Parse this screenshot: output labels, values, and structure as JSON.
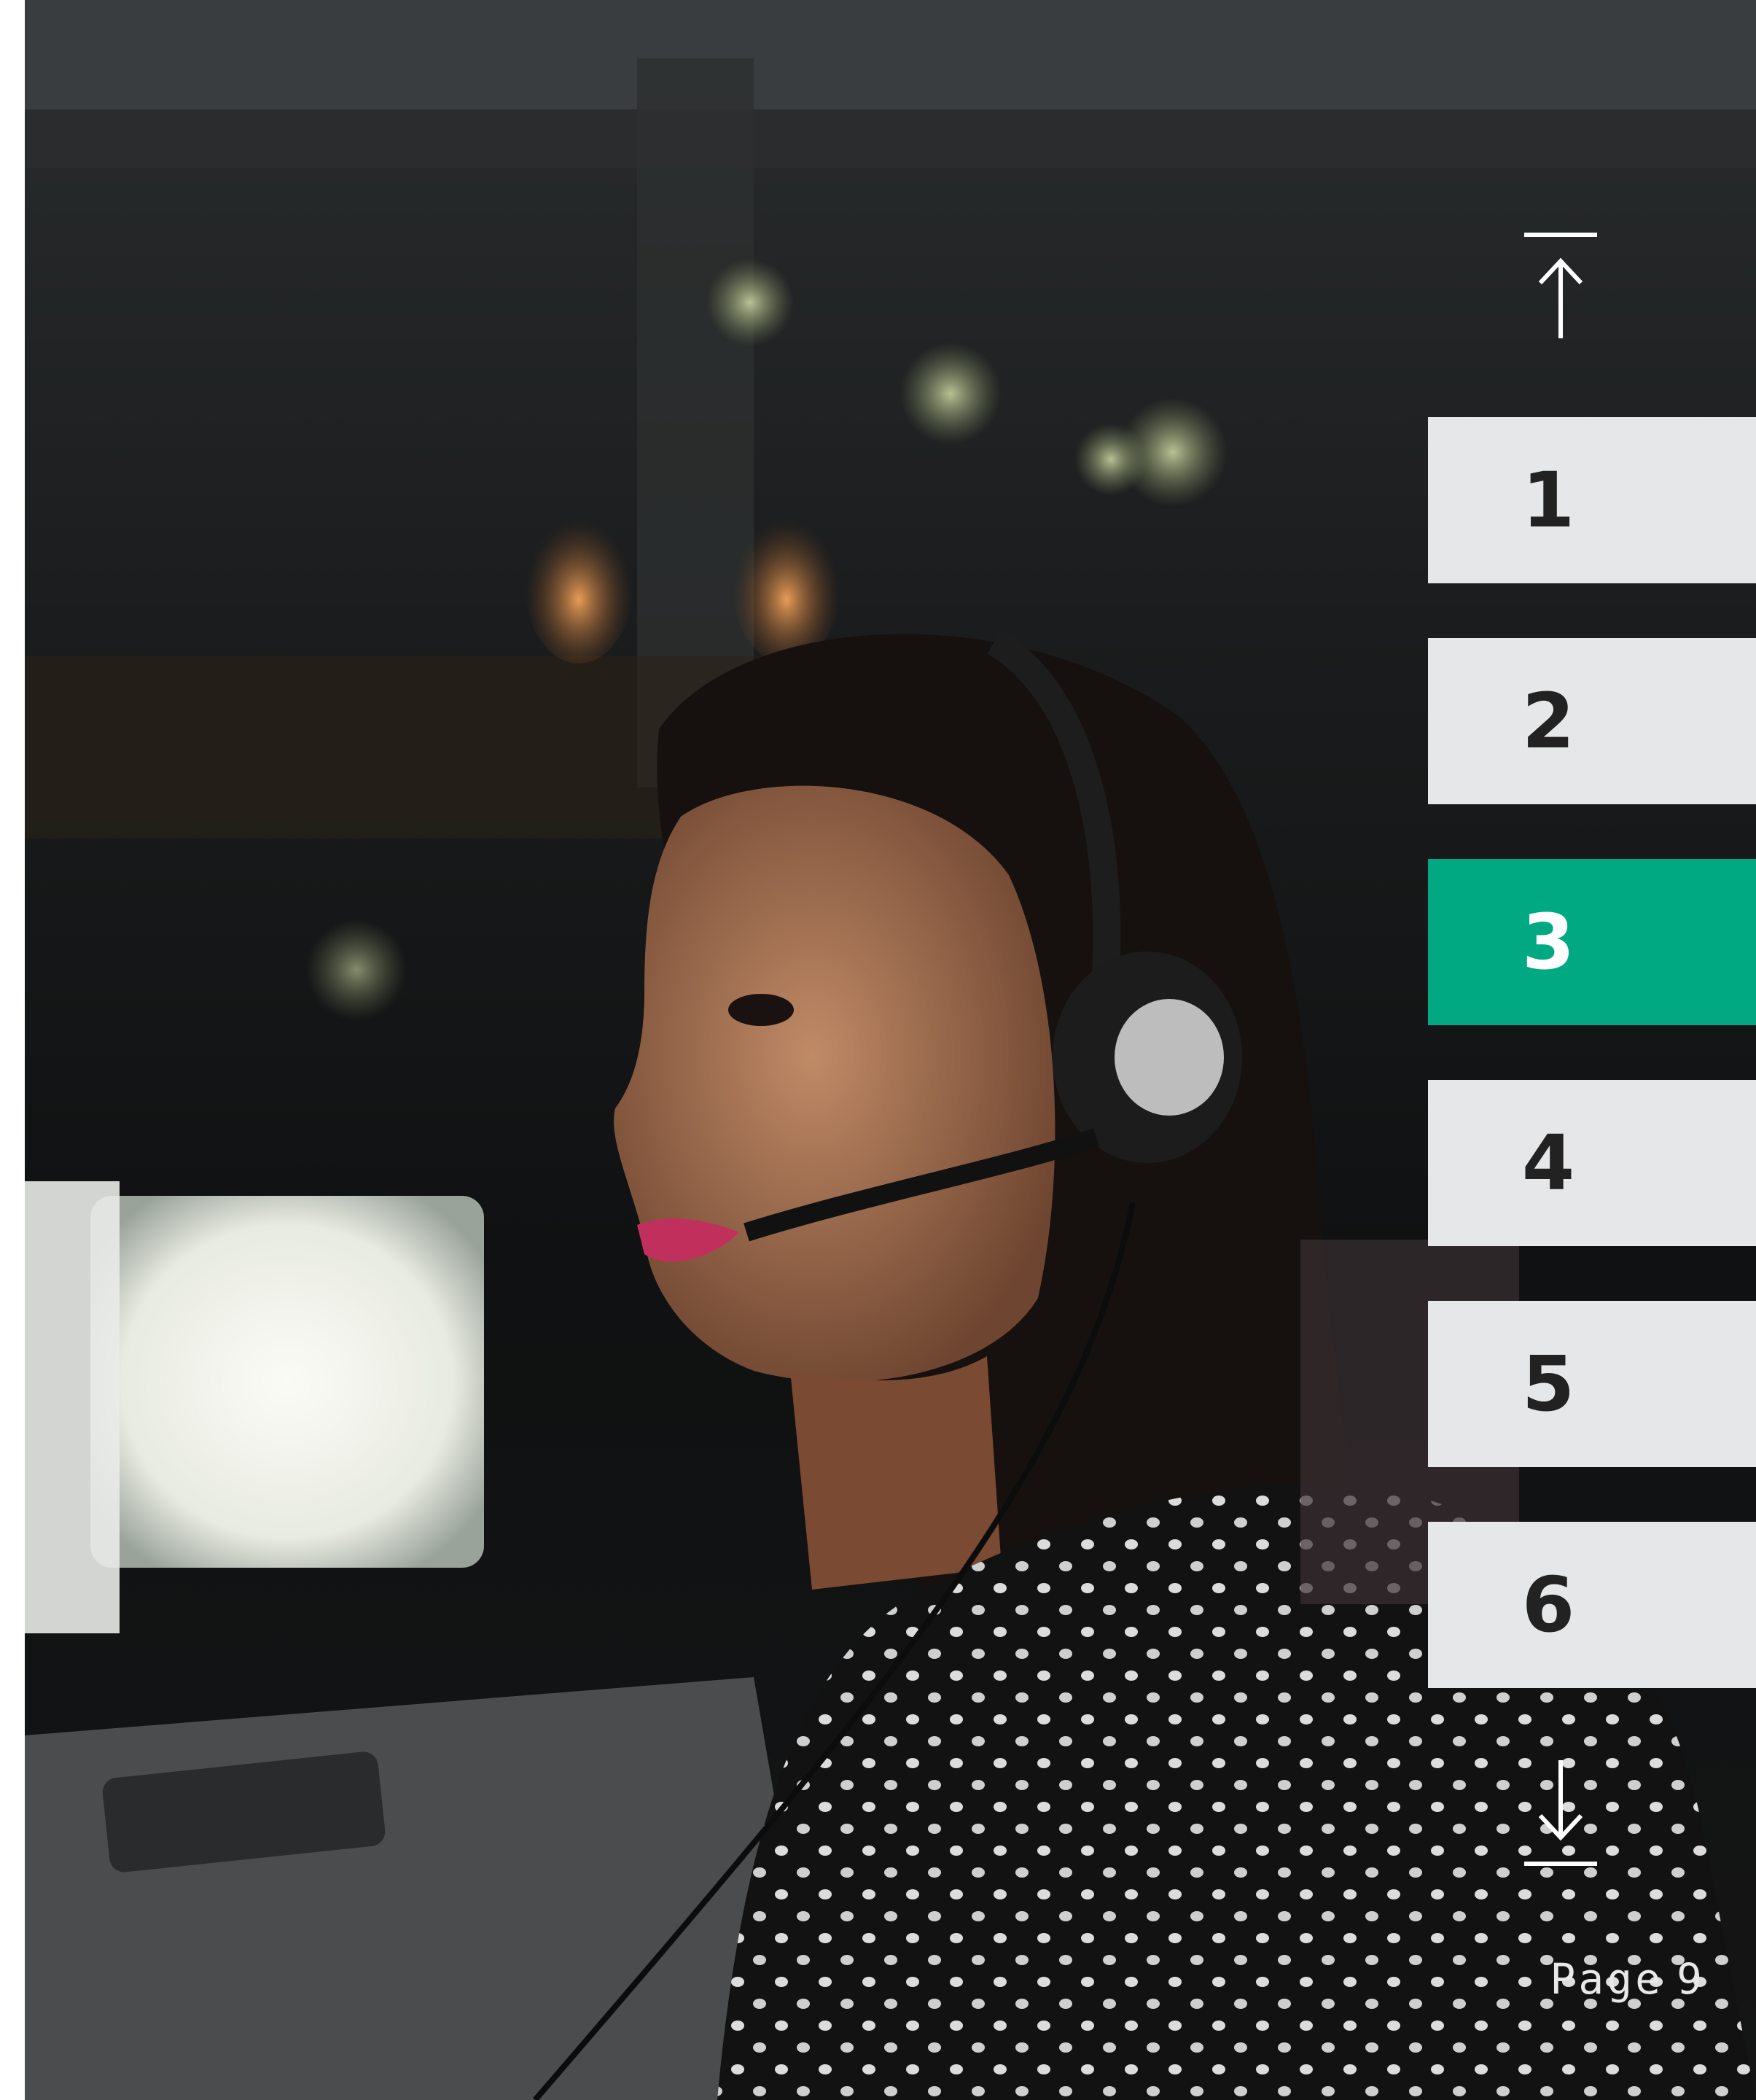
{
  "navigation": {
    "top_arrow_icon": "arrow-up-to-top-icon",
    "bottom_arrow_icon": "arrow-down-to-bottom-icon",
    "tabs": [
      {
        "label": "1",
        "active": false
      },
      {
        "label": "2",
        "active": false
      },
      {
        "label": "3",
        "active": true
      },
      {
        "label": "4",
        "active": false
      },
      {
        "label": "5",
        "active": false
      },
      {
        "label": "6",
        "active": false
      }
    ]
  },
  "footer": {
    "page_word": "Page",
    "page_value": "9"
  },
  "colors": {
    "active_tab": "#01a982",
    "inactive_tab": "#e6e7e8",
    "tab_text": "#222222"
  }
}
